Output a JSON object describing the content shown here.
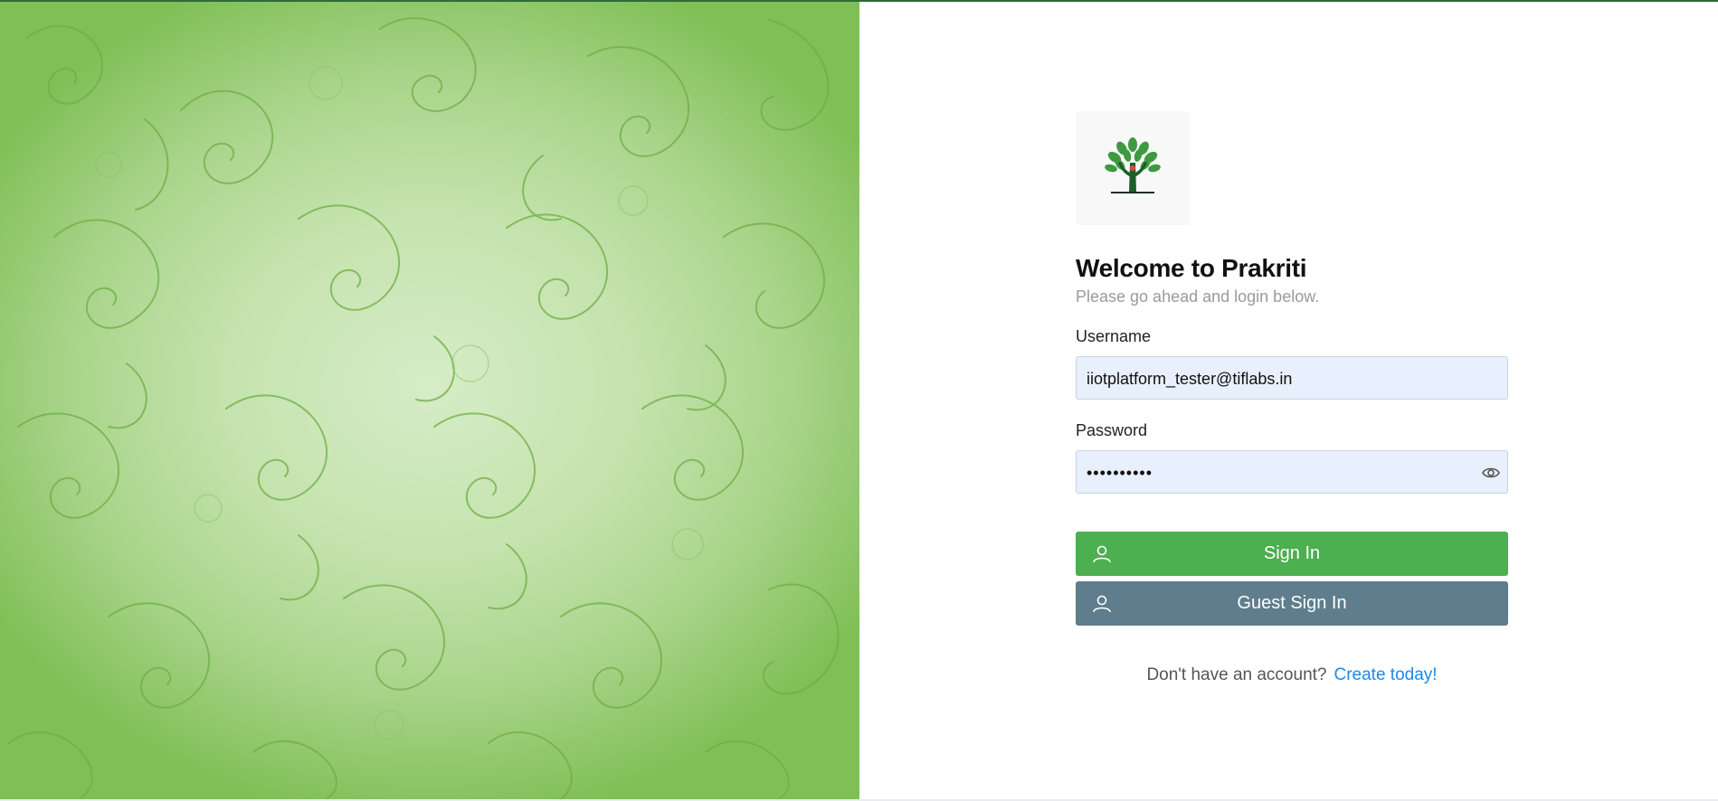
{
  "brand": {
    "logo": "tree-hands-logo"
  },
  "login": {
    "title": "Welcome to Prakriti",
    "subtitle": "Please go ahead and login below.",
    "username_label": "Username",
    "username_value": "iiotplatform_tester@tiflabs.in",
    "password_label": "Password",
    "password_value": "••••••••••",
    "password_toggle_icon": "eye-icon",
    "signin_label": "Sign In",
    "guest_label": "Guest Sign In",
    "button_icon": "user-icon",
    "signup_prompt": "Don't have an account?",
    "signup_link": "Create today!"
  },
  "colors": {
    "primary_green": "#4caf50",
    "guest_slate": "#5f7d8c",
    "link_blue": "#1e88e5",
    "input_bg": "#e8f0fe",
    "hero_green": "#7fbf55"
  }
}
